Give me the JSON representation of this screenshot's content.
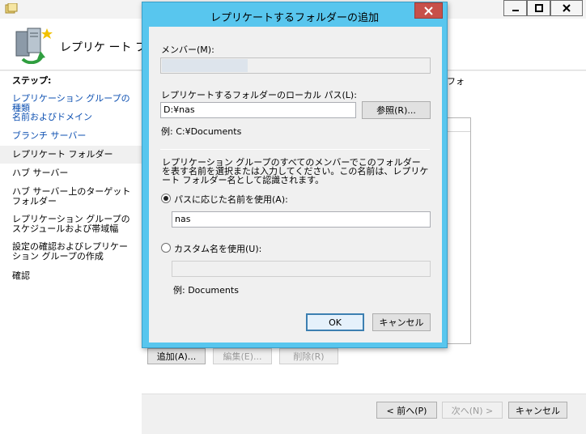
{
  "wizard": {
    "title": "レプリケ ート フォル",
    "partial_text": "フォ",
    "steps_heading": "ステップ:",
    "steps": [
      {
        "label": "レプリケーション グループの種類",
        "link": true
      },
      {
        "label": "名前およびドメイン",
        "link": true
      },
      {
        "label": "ブランチ サーバー",
        "link": true
      },
      {
        "label": "レプリケート フォルダー",
        "link": false,
        "current": true
      },
      {
        "label": "ハブ サーバー",
        "link": false
      },
      {
        "label": "ハブ サーバー上のターゲット フォルダー",
        "link": false
      },
      {
        "label": "レプリケーション グループのスケジュールおよび帯域幅",
        "link": false
      },
      {
        "label": "設定の確認およびレプリケーション グループの作成",
        "link": false
      },
      {
        "label": "確認",
        "link": false
      }
    ],
    "add_button": "追加(A)...",
    "edit_button": "編集(E)...",
    "delete_button": "削除(R)",
    "back_button": "< 前へ(P)",
    "next_button": "次へ(N) >",
    "cancel_button": "キャンセル"
  },
  "dialog": {
    "title": "レプリケートするフォルダーの追加",
    "member_label": "メンバー(M):",
    "member_value": "",
    "local_path_label": "レプリケートするフォルダーのローカル パス(L):",
    "local_path_value": "D:¥nas",
    "browse_button": "参照(R)...",
    "path_example": "例: C:¥Documents",
    "description": "レプリケーション グループのすべてのメンバーでこのフォルダーを表す名前を選択または入力してください。この名前は、レプリケート フォルダー名として認識されます。",
    "use_path_name_label": "パスに応じた名前を使用(A):",
    "path_name_value": "nas",
    "custom_name_label": "カスタム名を使用(U):",
    "custom_name_value": "",
    "custom_example": "例: Documents",
    "ok_button": "OK",
    "cancel_button": "キャンセル"
  },
  "icons": {
    "minimize": "minimize-icon",
    "maximize": "maximize-icon",
    "close": "close-icon",
    "wizard": "replication-server-icon"
  },
  "colors": {
    "dialog_frame": "#58c6ee",
    "close_button": "#c7504a",
    "link": "#0c4fb1"
  }
}
